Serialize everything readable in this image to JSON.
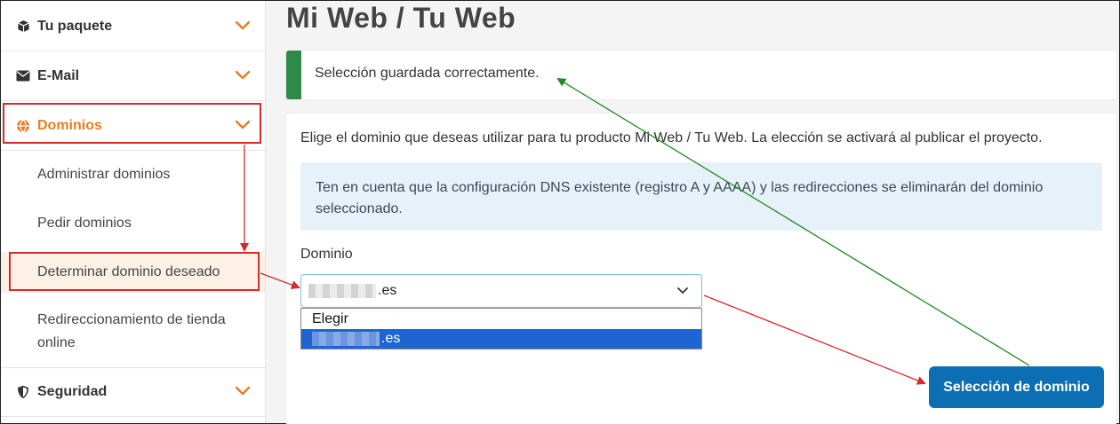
{
  "sidebar": {
    "items": [
      {
        "label": "Tu paquete",
        "icon": "package-icon"
      },
      {
        "label": "E-Mail",
        "icon": "envelope-icon"
      },
      {
        "label": "Dominios",
        "icon": "globe-icon"
      }
    ],
    "subitems": [
      {
        "label": "Administrar dominios"
      },
      {
        "label": "Pedir dominios"
      },
      {
        "label": "Determinar dominio deseado"
      },
      {
        "label": "Redireccionamiento de tienda online"
      }
    ],
    "security": {
      "label": "Seguridad",
      "icon": "shield-icon"
    }
  },
  "main": {
    "title": "Mi Web / Tu Web",
    "success_message": "Selección guardada correctamente.",
    "intro": "Elige el dominio que deseas utilizar para tu producto Mi Web / Tu Web. La elección se activará al publicar el proyecto.",
    "info": "Ten en cuenta que la configuración DNS existente (registro A y AAAA) y las redirecciones se eliminarán del dominio seleccionado.",
    "domain_label": "Dominio",
    "select_value_suffix": ".es",
    "options": [
      {
        "label": "Elegir"
      },
      {
        "label": ".es"
      }
    ],
    "button_label": "Selección de dominio"
  },
  "colors": {
    "accent_orange": "#e67e22",
    "success_green": "#2f8a47",
    "primary_blue": "#0c6fb3",
    "annotation_red": "#d52b2b",
    "annotation_green": "#1e8a1e"
  }
}
